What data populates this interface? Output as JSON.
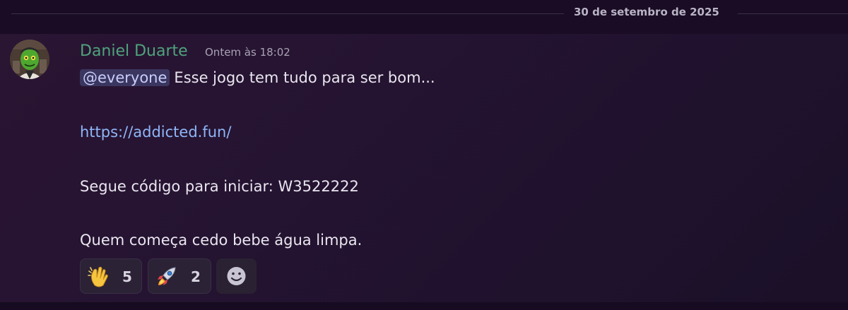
{
  "divider": {
    "date": "30 de setembro de 2025"
  },
  "message": {
    "author": "Daniel Duarte",
    "timestamp": "Ontem às 18:02",
    "mention": "@everyone",
    "line1_text": "Esse jogo tem tudo para ser bom...",
    "link": "https://addicted.fun/",
    "line3": "Segue código para iniciar: W3522222",
    "line4": "Quem começa cedo bebe água limpa."
  },
  "reactions": [
    {
      "emoji": "clapping-hands-icon",
      "count": "5"
    },
    {
      "emoji": "rocket-icon",
      "count": "2"
    }
  ],
  "colors": {
    "author": "#4fa37c",
    "link": "#8fb6f7",
    "mention_bg": "#3a3660",
    "mention_text": "#c9cdfb"
  }
}
